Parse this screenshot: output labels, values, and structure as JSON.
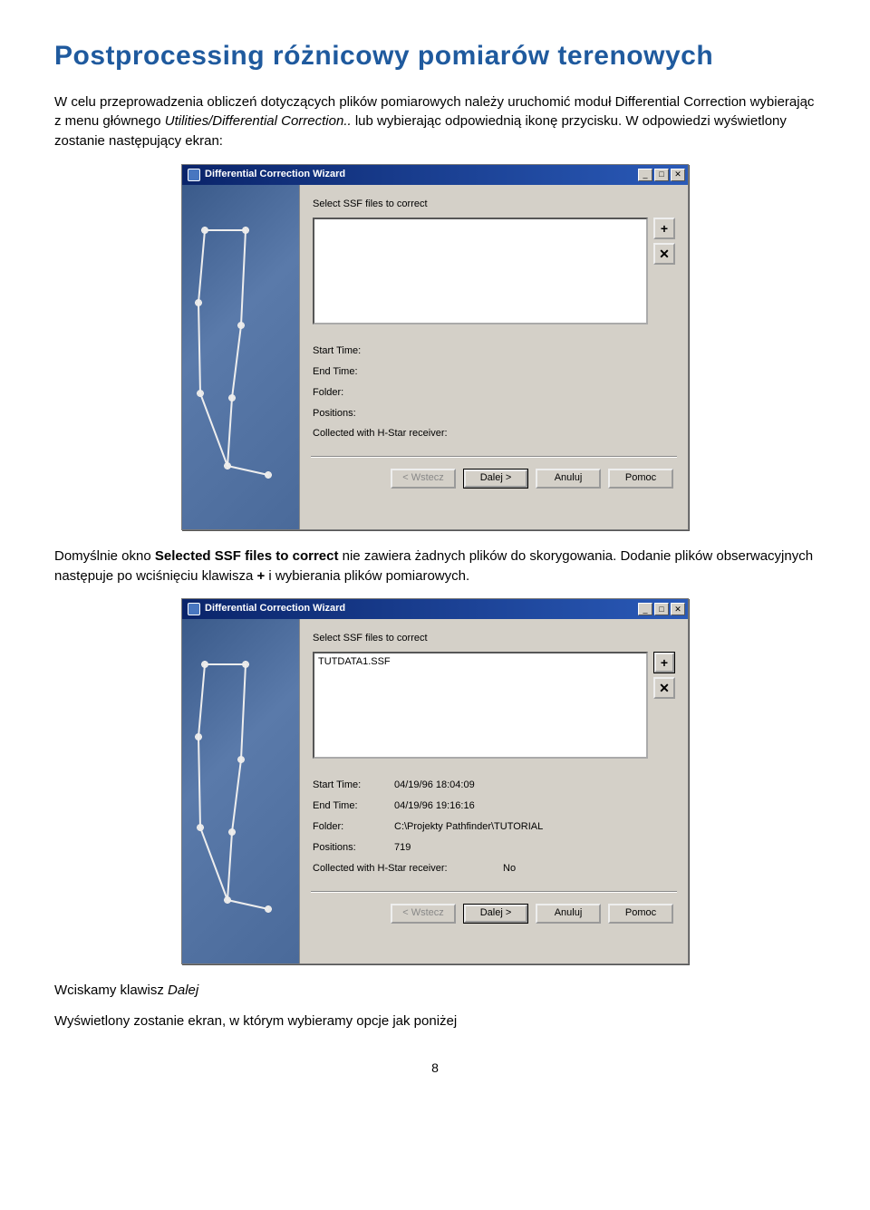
{
  "heading": "Postprocessing różnicowy pomiarów terenowych",
  "para1_a": "W celu przeprowadzenia obliczeń dotyczących plików pomiarowych należy uruchomić moduł Differential Correction wybierając z menu głównego ",
  "para1_i": "Utilities/Differential Correction..",
  "para1_b": " lub wybierając odpowiednią ikonę przycisku. W odpowiedzi wyświetlony zostanie następujący ekran:",
  "para2_a": "Domyślnie okno ",
  "para2_bold": "Selected SSF files to correct",
  "para2_b": " nie zawiera żadnych plików do skorygowania. Dodanie plików obserwacyjnych następuje po wciśnięciu klawisza ",
  "para2_plus": "+",
  "para2_c": " i wybierania plików pomiarowych.",
  "para3_a": "Wciskamy klawisz ",
  "para3_i": "Dalej",
  "para4": "Wyświetlony zostanie ekran, w którym wybieramy opcje jak poniżej",
  "pagenum": "8",
  "wizard": {
    "title": "Differential Correction Wizard",
    "select_label": "Select SSF files to correct",
    "start_label": "Start Time:",
    "end_label": "End Time:",
    "folder_label": "Folder:",
    "positions_label": "Positions:",
    "hstar_label": "Collected with H-Star receiver:",
    "btn_back": "< Wstecz",
    "btn_next": "Dalej >",
    "btn_cancel": "Anuluj",
    "btn_help": "Pomoc"
  },
  "wiz1": {
    "file": "",
    "start": "",
    "end": "",
    "folder": "",
    "positions": "",
    "hstar": ""
  },
  "wiz2": {
    "file": "TUTDATA1.SSF",
    "start": "04/19/96 18:04:09",
    "end": "04/19/96 19:16:16",
    "folder": "C:\\Projekty Pathfinder\\TUTORIAL",
    "positions": "719",
    "hstar": "No"
  }
}
